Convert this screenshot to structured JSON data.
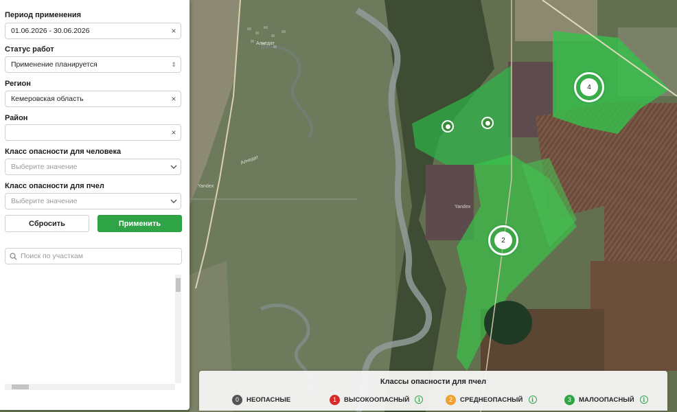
{
  "filters": {
    "period": {
      "label": "Период применения",
      "value": "01.06.2026 - 30.06.2026"
    },
    "status": {
      "label": "Статус работ",
      "value": "Применение планируется"
    },
    "region": {
      "label": "Регион",
      "value": "Кемеровская область"
    },
    "district": {
      "label": "Район",
      "value": ""
    },
    "human_class": {
      "label": "Класс опасности для человека",
      "placeholder": "Выберите значение"
    },
    "bee_class": {
      "label": "Класс опасности для пчел",
      "placeholder": "Выберите значение"
    }
  },
  "buttons": {
    "reset": "Сбросить",
    "apply": "Применить"
  },
  "search": {
    "placeholder": "Поиск по участкам"
  },
  "map": {
    "clusters": [
      {
        "count": "4"
      },
      {
        "count": "2"
      }
    ],
    "labels": [
      "Алчедат",
      "Алчедат",
      "Yandex",
      "Yandex"
    ]
  },
  "legend": {
    "title": "Классы опасности для пчел",
    "items": [
      {
        "num": "0",
        "label": "НЕОПАСНЫЕ",
        "color": "#555555",
        "info": false
      },
      {
        "num": "1",
        "label": "ВЫСОКООПАСНЫЙ",
        "color": "#d62b2b",
        "info": true
      },
      {
        "num": "2",
        "label": "СРЕДНЕОПАСНЫЙ",
        "color": "#f0a030",
        "info": true
      },
      {
        "num": "3",
        "label": "МАЛООПАСНЫЙ",
        "color": "#2fa446",
        "info": true
      }
    ],
    "info_glyph": "i"
  },
  "icons": {
    "clear": "×",
    "chevron": "⌄",
    "updown": "⇕"
  }
}
